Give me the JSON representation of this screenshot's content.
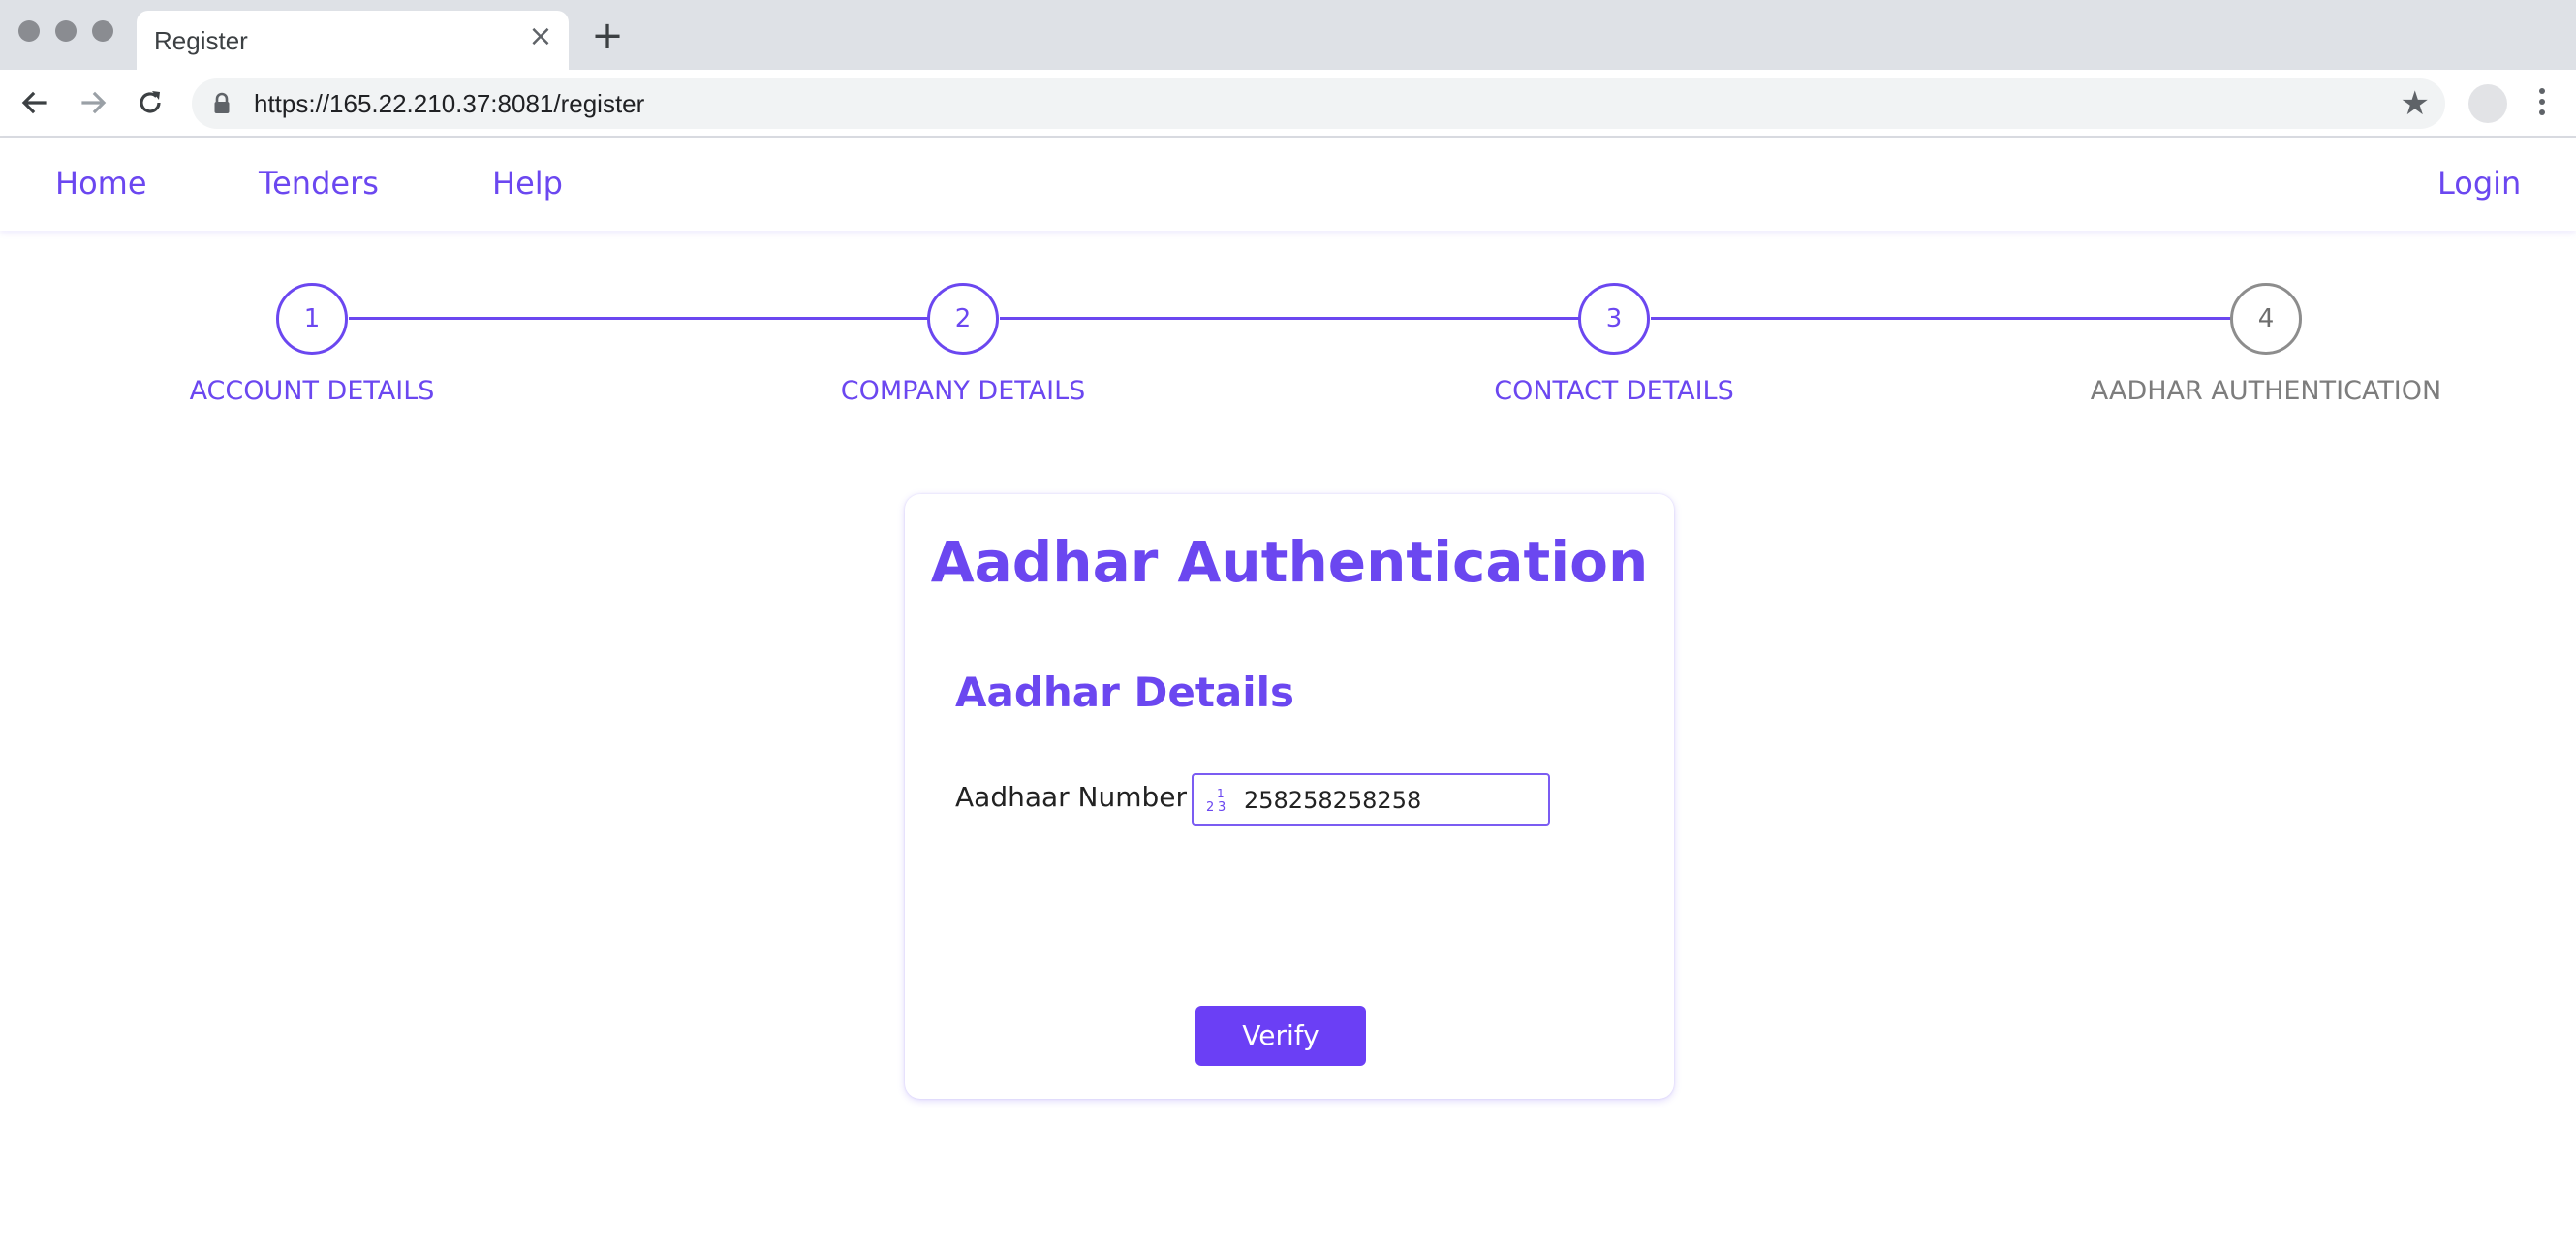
{
  "browser": {
    "tab_title": "Register",
    "tab_close_glyph": "×",
    "new_tab_glyph": "+",
    "url": "https://165.22.210.37:8081/register",
    "bookmark_glyph": "★",
    "icons": {
      "back": "arrow-left-icon",
      "forward": "arrow-right-icon",
      "reload": "reload-icon",
      "lock": "lock-icon",
      "bookmark": "star-icon",
      "menu": "kebab-menu-icon"
    }
  },
  "nav": {
    "items": [
      {
        "label": "Home"
      },
      {
        "label": "Tenders"
      },
      {
        "label": "Help"
      }
    ],
    "login": "Login"
  },
  "stepper": {
    "steps": [
      {
        "number": "1",
        "label": "ACCOUNT DETAILS",
        "state": "done"
      },
      {
        "number": "2",
        "label": "COMPANY DETAILS",
        "state": "done"
      },
      {
        "number": "3",
        "label": "CONTACT DETAILS",
        "state": "done"
      },
      {
        "number": "4",
        "label": "AADHAR AUTHENTICATION",
        "state": "current"
      }
    ]
  },
  "card": {
    "title": "Aadhar Authentication",
    "section_title": "Aadhar Details",
    "aadhaar_label": "Aadhaar Number",
    "aadhaar_value": "258258258258",
    "aadhaar_icon": "numeric-input-icon",
    "verify_label": "Verify"
  },
  "colors": {
    "accent": "#6b47f0",
    "button": "#6b3ff5",
    "inactive": "#8d8d8d"
  }
}
